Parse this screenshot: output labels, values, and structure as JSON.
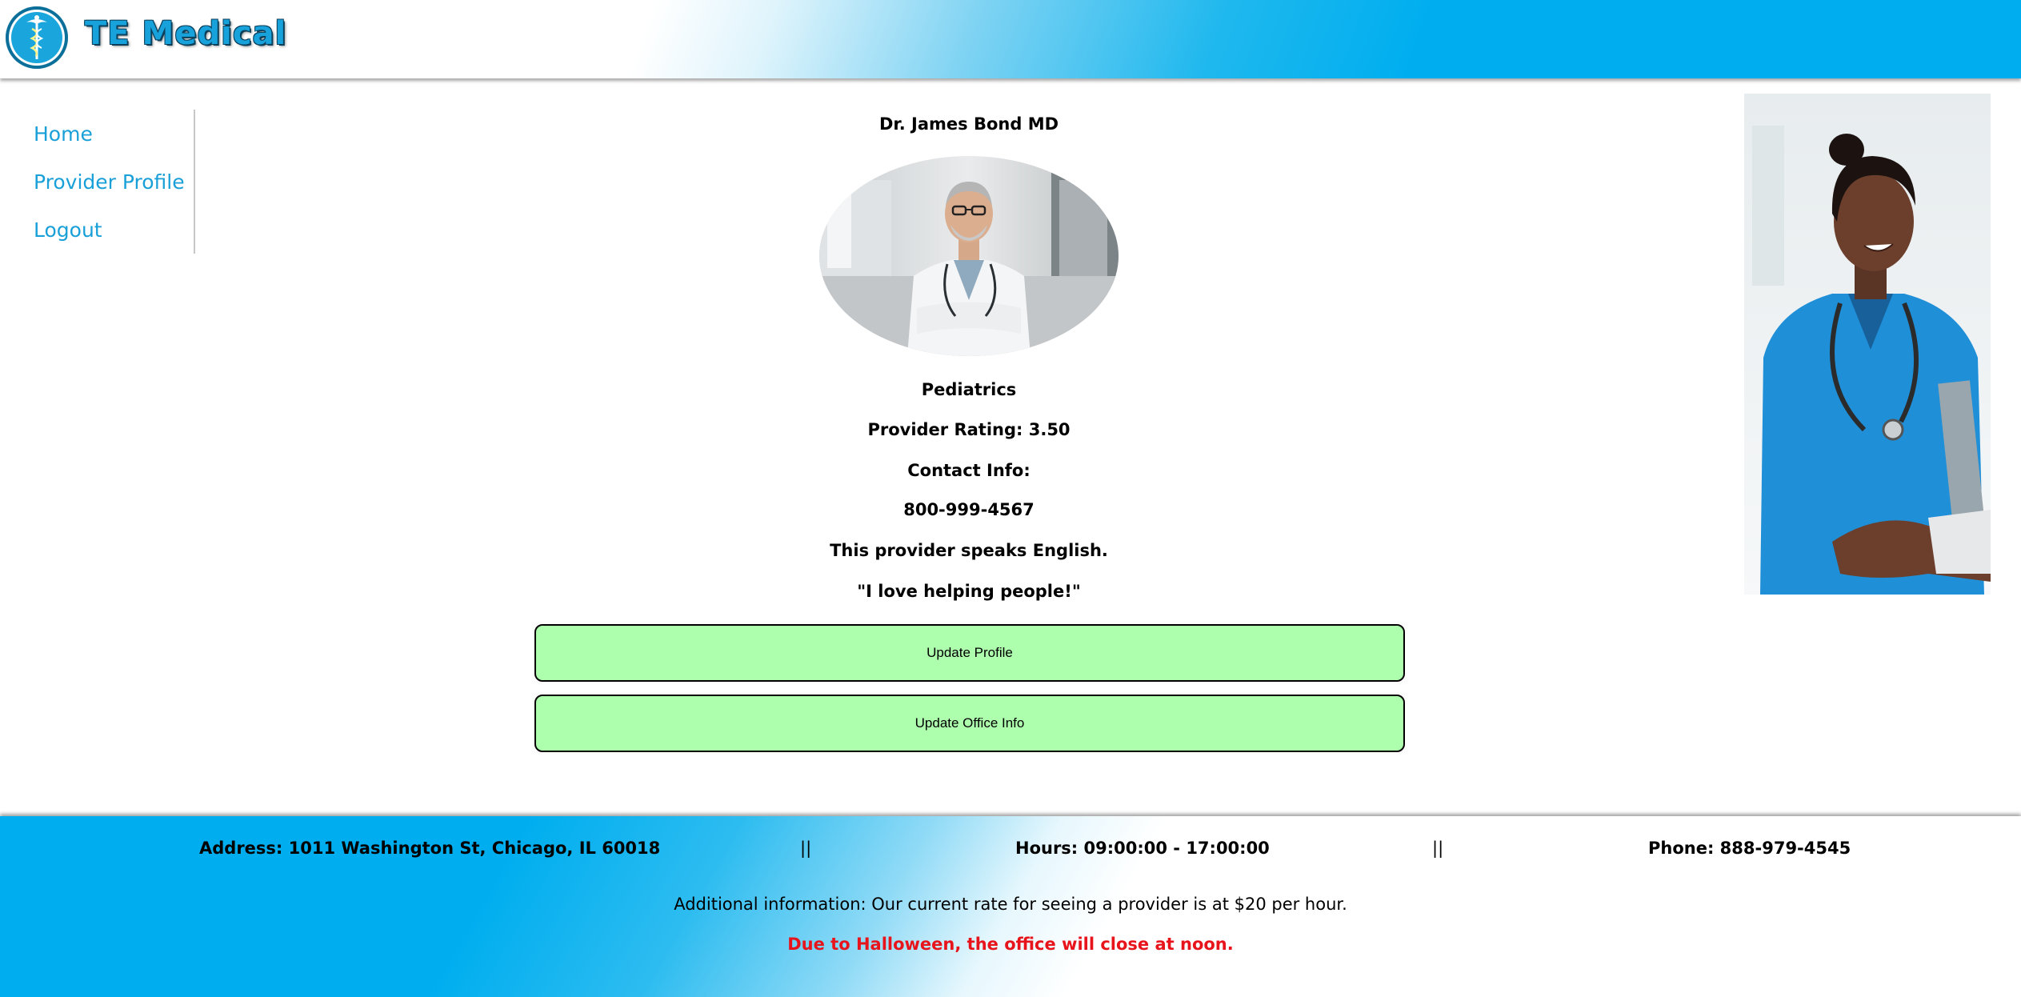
{
  "header": {
    "brand": "TE Medical",
    "logo_icon": "caduceus-icon"
  },
  "nav": {
    "items": [
      {
        "label": "Home"
      },
      {
        "label": "Provider Profile"
      },
      {
        "label": "Logout"
      }
    ]
  },
  "profile": {
    "name": "Dr. James Bond MD",
    "photo_icon": "doctor-portrait",
    "specialty": "Pediatrics",
    "rating": "Provider Rating: 3.50",
    "contact_heading": "Contact Info:",
    "phone": "800-999-4567",
    "languages": "This provider speaks English.",
    "quote": "\"I love helping people!\"",
    "update_profile_label": "Update Profile",
    "update_office_label": "Update Office Info"
  },
  "side_image": {
    "icon": "nurse-photo"
  },
  "footer": {
    "address": "Address: 1011 Washington St, Chicago, IL 60018",
    "separator": "||",
    "hours": "Hours: 09:00:00 - 17:00:00",
    "phone": "Phone: 888-979-4545",
    "additional": "Additional information: Our current rate for seeing a provider is at $20 per hour.",
    "alert": "Due to Halloween, the office will close at noon."
  },
  "colors": {
    "brand_blue": "#00aeef",
    "link_blue": "#1aa0d8",
    "button_green": "#adffad",
    "alert_red": "#e8141b"
  }
}
